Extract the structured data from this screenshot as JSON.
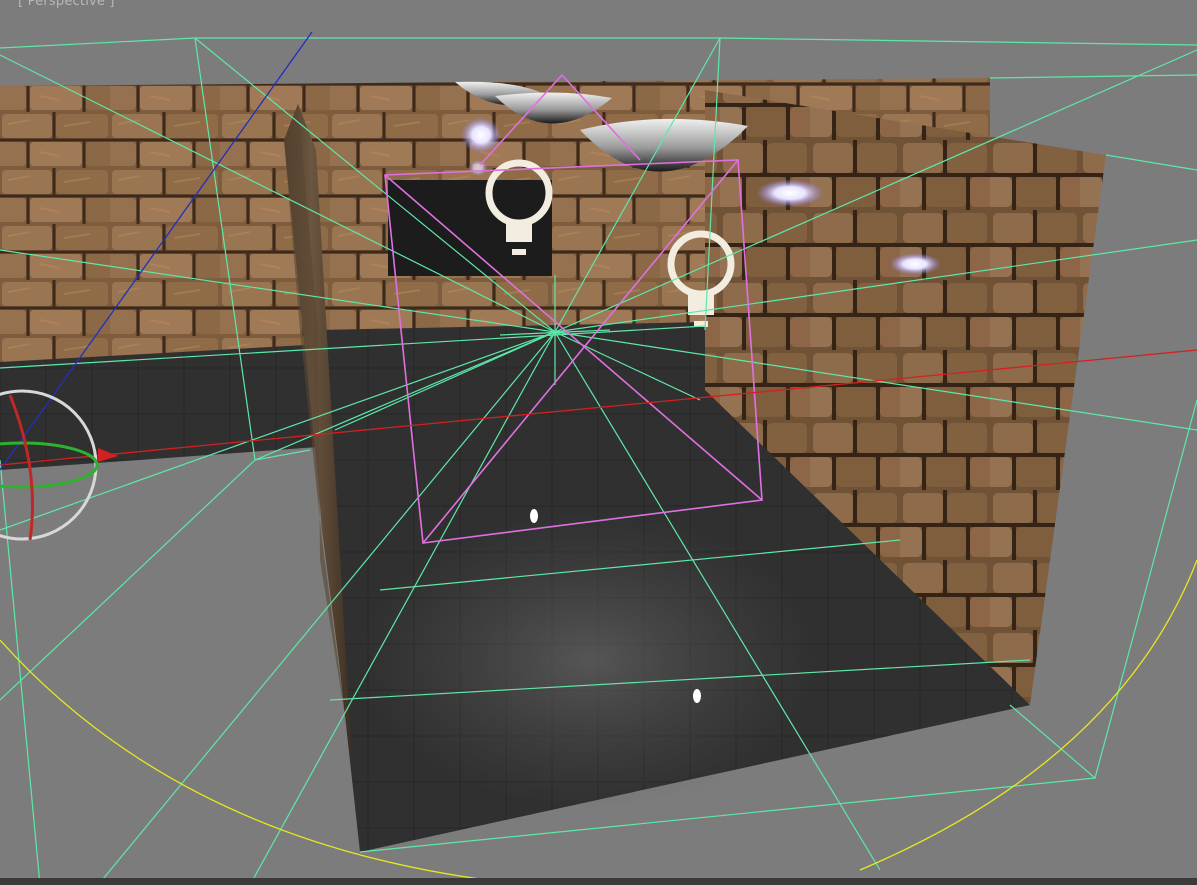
{
  "viewport": {
    "label": "[ Perspective ]"
  },
  "colors": {
    "background": "#7c7c7c",
    "wall_stone": "#8a6543",
    "floor": "#2a2a2a",
    "gizmo_green": "#5ee8a8",
    "light_magenta": "#e070e0",
    "axis_red": "#d42020",
    "axis_blue": "#2030c0",
    "light_yellow": "#e8e820"
  },
  "icons": {
    "light_bulb_1": "light-bulb-icon",
    "light_bulb_2": "light-bulb-icon",
    "view_orientation_gizmo": "orbit-gizmo-icon"
  }
}
